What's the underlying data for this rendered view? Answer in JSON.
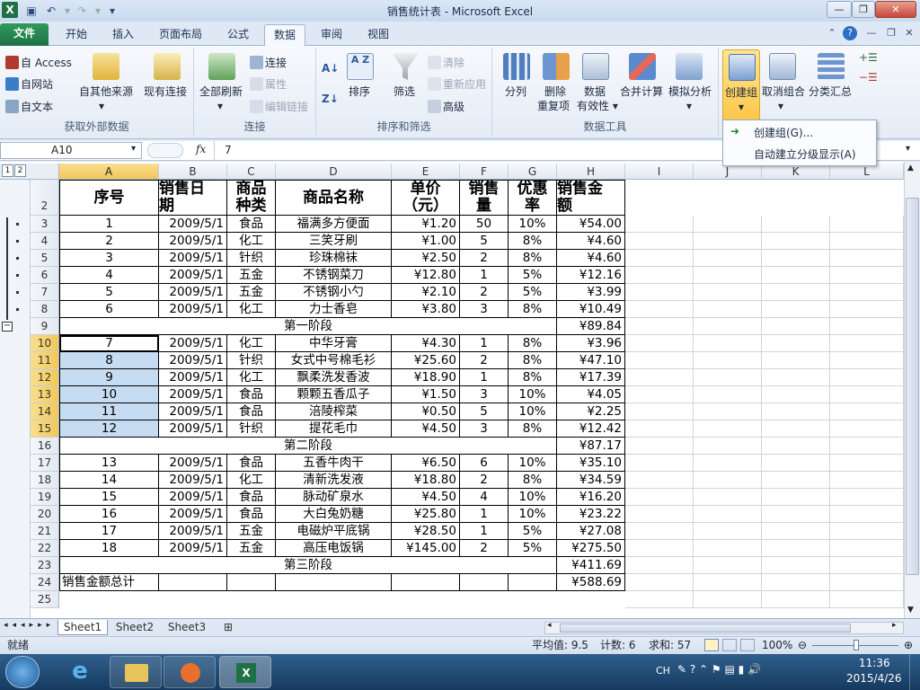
{
  "window": {
    "title": "销售统计表 - Microsoft Excel"
  },
  "quick_access": {
    "save_icon": "save-icon",
    "undo_icon": "undo-icon",
    "redo_icon": "redo-icon",
    "customize_icon": "dropdown-icon"
  },
  "tabs": [
    {
      "label": "文件"
    },
    {
      "label": "开始"
    },
    {
      "label": "插入"
    },
    {
      "label": "页面布局"
    },
    {
      "label": "公式"
    },
    {
      "label": "数据"
    },
    {
      "label": "审阅"
    },
    {
      "label": "视图"
    }
  ],
  "ribbon": {
    "get_external": {
      "group_label": "获取外部数据",
      "access": "自 Access",
      "web": "自网站",
      "text": "自文本",
      "other": "自其他来源",
      "existing": "现有连接"
    },
    "connections": {
      "group_label": "连接",
      "refresh_all": "全部刷新",
      "connections": "连接",
      "properties": "属性",
      "edit_links": "编辑链接"
    },
    "sort_filter": {
      "group_label": "排序和筛选",
      "sort": "排序",
      "filter": "筛选",
      "clear": "清除",
      "reapply": "重新应用",
      "advanced": "高级"
    },
    "data_tools": {
      "group_label": "数据工具",
      "text_to_columns": "分列",
      "remove_dup_1": "删除",
      "remove_dup_2": "重复项",
      "validation_1": "数据",
      "validation_2": "有效性",
      "consolidate": "合并计算",
      "what_if": "模拟分析"
    },
    "outline": {
      "group": "创建组",
      "ungroup": "取消组合",
      "subtotal": "分类汇总"
    }
  },
  "dropdown": {
    "items": [
      "创建组(G)...",
      "自动建立分级显示(A)"
    ]
  },
  "formula_bar": {
    "name_box": "A10",
    "fx": "fx",
    "value": "7"
  },
  "outline_levels": [
    "1",
    "2"
  ],
  "columns": [
    "A",
    "B",
    "C",
    "D",
    "E",
    "F",
    "G",
    "H",
    "I",
    "J",
    "K",
    "L"
  ],
  "header_row": {
    "row": "2",
    "cells": [
      [
        "序号"
      ],
      [
        "销售日",
        "期"
      ],
      [
        "商品",
        "种类"
      ],
      [
        "商品名称"
      ],
      [
        "单价",
        "（元）"
      ],
      [
        "销售",
        "量"
      ],
      [
        "优惠",
        "率"
      ],
      [
        "销售金",
        "额"
      ]
    ]
  },
  "rows": [
    {
      "row": "3",
      "cells": [
        "1",
        "2009/5/1",
        "食品",
        "福满多方便面",
        "¥1.20",
        "50",
        "10%",
        "¥54.00"
      ]
    },
    {
      "row": "4",
      "cells": [
        "2",
        "2009/5/1",
        "化工",
        "三笑牙刷",
        "¥1.00",
        "5",
        "8%",
        "¥4.60"
      ]
    },
    {
      "row": "5",
      "cells": [
        "3",
        "2009/5/1",
        "针织",
        "珍珠棉袜",
        "¥2.50",
        "2",
        "8%",
        "¥4.60"
      ]
    },
    {
      "row": "6",
      "cells": [
        "4",
        "2009/5/1",
        "五金",
        "不锈钢菜刀",
        "¥12.80",
        "1",
        "5%",
        "¥12.16"
      ]
    },
    {
      "row": "7",
      "cells": [
        "5",
        "2009/5/1",
        "五金",
        "不锈钢小勺",
        "¥2.10",
        "2",
        "5%",
        "¥3.99"
      ]
    },
    {
      "row": "8",
      "cells": [
        "6",
        "2009/5/1",
        "化工",
        "力士香皂",
        "¥3.80",
        "3",
        "8%",
        "¥10.49"
      ]
    },
    {
      "row": "9",
      "stage": "第一阶段",
      "total": "¥89.84"
    },
    {
      "row": "10",
      "cells": [
        "7",
        "2009/5/1",
        "化工",
        "中华牙膏",
        "¥4.30",
        "1",
        "8%",
        "¥3.96"
      ]
    },
    {
      "row": "11",
      "cells": [
        "8",
        "2009/5/1",
        "针织",
        "女式中号棉毛衫",
        "¥25.60",
        "2",
        "8%",
        "¥47.10"
      ]
    },
    {
      "row": "12",
      "cells": [
        "9",
        "2009/5/1",
        "化工",
        "飘柔洗发香波",
        "¥18.90",
        "1",
        "8%",
        "¥17.39"
      ]
    },
    {
      "row": "13",
      "cells": [
        "10",
        "2009/5/1",
        "食品",
        "颗颗五香瓜子",
        "¥1.50",
        "3",
        "10%",
        "¥4.05"
      ]
    },
    {
      "row": "14",
      "cells": [
        "11",
        "2009/5/1",
        "食品",
        "涪陵榨菜",
        "¥0.50",
        "5",
        "10%",
        "¥2.25"
      ]
    },
    {
      "row": "15",
      "cells": [
        "12",
        "2009/5/1",
        "针织",
        "提花毛巾",
        "¥4.50",
        "3",
        "8%",
        "¥12.42"
      ]
    },
    {
      "row": "16",
      "stage": "第二阶段",
      "total": "¥87.17"
    },
    {
      "row": "17",
      "cells": [
        "13",
        "2009/5/1",
        "食品",
        "五香牛肉干",
        "¥6.50",
        "6",
        "10%",
        "¥35.10"
      ]
    },
    {
      "row": "18",
      "cells": [
        "14",
        "2009/5/1",
        "化工",
        "清新洗发液",
        "¥18.80",
        "2",
        "8%",
        "¥34.59"
      ]
    },
    {
      "row": "19",
      "cells": [
        "15",
        "2009/5/1",
        "食品",
        "脉动矿泉水",
        "¥4.50",
        "4",
        "10%",
        "¥16.20"
      ]
    },
    {
      "row": "20",
      "cells": [
        "16",
        "2009/5/1",
        "食品",
        "大白兔奶糖",
        "¥25.80",
        "1",
        "10%",
        "¥23.22"
      ]
    },
    {
      "row": "21",
      "cells": [
        "17",
        "2009/5/1",
        "五金",
        "电磁炉平底锅",
        "¥28.50",
        "1",
        "5%",
        "¥27.08"
      ]
    },
    {
      "row": "22",
      "cells": [
        "18",
        "2009/5/1",
        "五金",
        "高压电饭锅",
        "¥145.00",
        "2",
        "5%",
        "¥275.50"
      ]
    },
    {
      "row": "23",
      "stage": "第三阶段",
      "total": "¥411.69"
    },
    {
      "row": "24",
      "grand": "销售金额总计",
      "total": "¥588.69"
    },
    {
      "row": "25"
    }
  ],
  "selected_rows": [
    "10",
    "11",
    "12",
    "13",
    "14",
    "15"
  ],
  "sheets": [
    "Sheet1",
    "Sheet2",
    "Sheet3"
  ],
  "status": {
    "ready": "就绪",
    "average": "平均值: 9.5",
    "count": "计数: 6",
    "sum": "求和: 57",
    "zoom": "100%"
  },
  "taskbar": {
    "ime": "CH",
    "time": "11:36",
    "date": "2015/4/26"
  },
  "colors": {
    "excel_green": "#1e7145",
    "selection": "#c6dcf3",
    "header_highlight": "#f1c75a"
  }
}
